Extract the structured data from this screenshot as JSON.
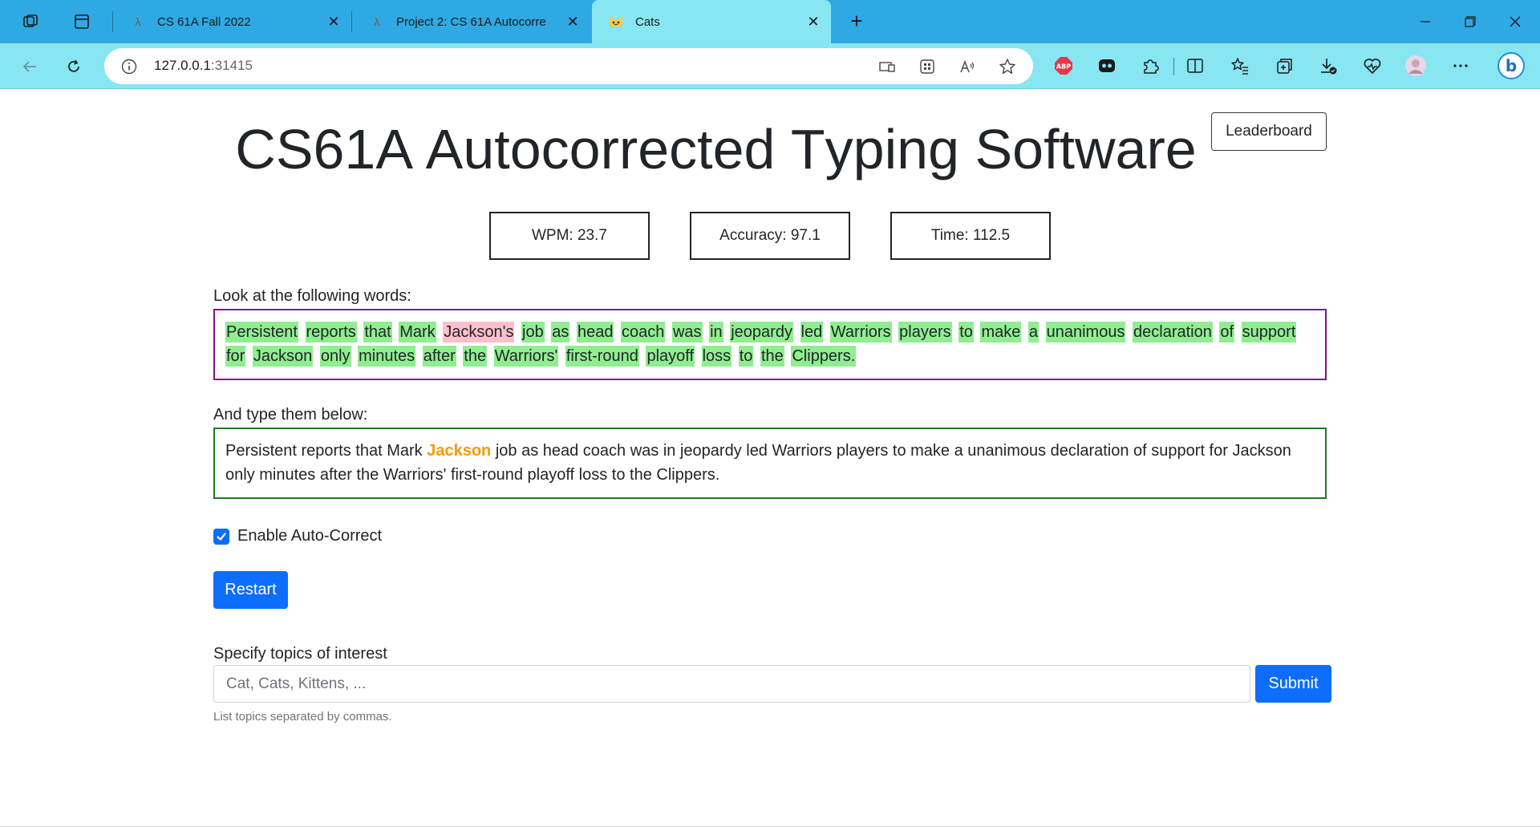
{
  "browser": {
    "tabs": [
      {
        "title": "CS 61A Fall 2022",
        "favicon": "lambda-icon"
      },
      {
        "title": "Project 2: CS 61A Autocorre",
        "favicon": "lambda-icon"
      },
      {
        "title": "Cats",
        "favicon": "cat-emoji-icon",
        "active": true
      }
    ],
    "url_host": "127.0.0.1",
    "url_port": ":31415"
  },
  "page": {
    "leaderboard_label": "Leaderboard",
    "title": {
      "c": "C",
      "s61a": "S61A ",
      "a": "A",
      "utocorrected": "utocorrected ",
      "t": "T",
      "yping": "yping ",
      "s2": "S",
      "oftware": "oftware"
    },
    "stats": {
      "wpm": "WPM: 23.7",
      "accuracy": "Accuracy: 97.1",
      "time": "Time: 112.5"
    },
    "prompt_label": "Look at the following words:",
    "prompt_words": [
      {
        "w": "Persistent",
        "s": "ok"
      },
      {
        "w": "reports",
        "s": "ok"
      },
      {
        "w": "that",
        "s": "ok"
      },
      {
        "w": "Mark",
        "s": "ok"
      },
      {
        "w": "Jackson's",
        "s": "bad"
      },
      {
        "w": "job",
        "s": "ok"
      },
      {
        "w": "as",
        "s": "ok"
      },
      {
        "w": "head",
        "s": "ok"
      },
      {
        "w": "coach",
        "s": "ok"
      },
      {
        "w": "was",
        "s": "ok"
      },
      {
        "w": "in",
        "s": "ok"
      },
      {
        "w": "jeopardy",
        "s": "ok"
      },
      {
        "w": "led",
        "s": "ok"
      },
      {
        "w": "Warriors",
        "s": "ok"
      },
      {
        "w": "players",
        "s": "ok"
      },
      {
        "w": "to",
        "s": "ok"
      },
      {
        "w": "make",
        "s": "ok"
      },
      {
        "w": "a",
        "s": "ok"
      },
      {
        "w": "unanimous",
        "s": "ok"
      },
      {
        "w": "declaration",
        "s": "ok"
      },
      {
        "w": "of",
        "s": "ok"
      },
      {
        "w": "support",
        "s": "ok"
      },
      {
        "w": "for",
        "s": "ok"
      },
      {
        "w": "Jackson",
        "s": "ok"
      },
      {
        "w": "only",
        "s": "ok"
      },
      {
        "w": "minutes",
        "s": "ok"
      },
      {
        "w": "after",
        "s": "ok"
      },
      {
        "w": "the",
        "s": "ok"
      },
      {
        "w": "Warriors'",
        "s": "ok"
      },
      {
        "w": "first-round",
        "s": "ok"
      },
      {
        "w": "playoff",
        "s": "ok"
      },
      {
        "w": "loss",
        "s": "ok"
      },
      {
        "w": "to",
        "s": "ok"
      },
      {
        "w": "the",
        "s": "ok"
      },
      {
        "w": "Clippers.",
        "s": "ok"
      }
    ],
    "typed_label": "And type them below:",
    "typed_before": "Persistent reports that Mark ",
    "typed_corrected": "Jackson",
    "typed_after": " job as head coach was in jeopardy led Warriors players to make a unanimous declaration of support for Jackson only minutes after the Warriors' first-round playoff loss to the Clippers.",
    "autocorrect_label": "Enable Auto-Correct",
    "autocorrect_checked": true,
    "restart_label": "Restart",
    "topics_label": "Specify topics of interest",
    "topics_placeholder": "Cat, Cats, Kittens, ...",
    "topics_value": "",
    "submit_label": "Submit",
    "topics_help": "List topics separated by commas.",
    "colors": {
      "correct_word_bg": "#90ee90",
      "wrong_word_bg": "#ffc0cb",
      "prompt_border": "#8b0d8b",
      "typed_border": "#1e7d1e",
      "autocorrected_word": "#f59b00",
      "primary_button": "#0d6efd"
    }
  }
}
